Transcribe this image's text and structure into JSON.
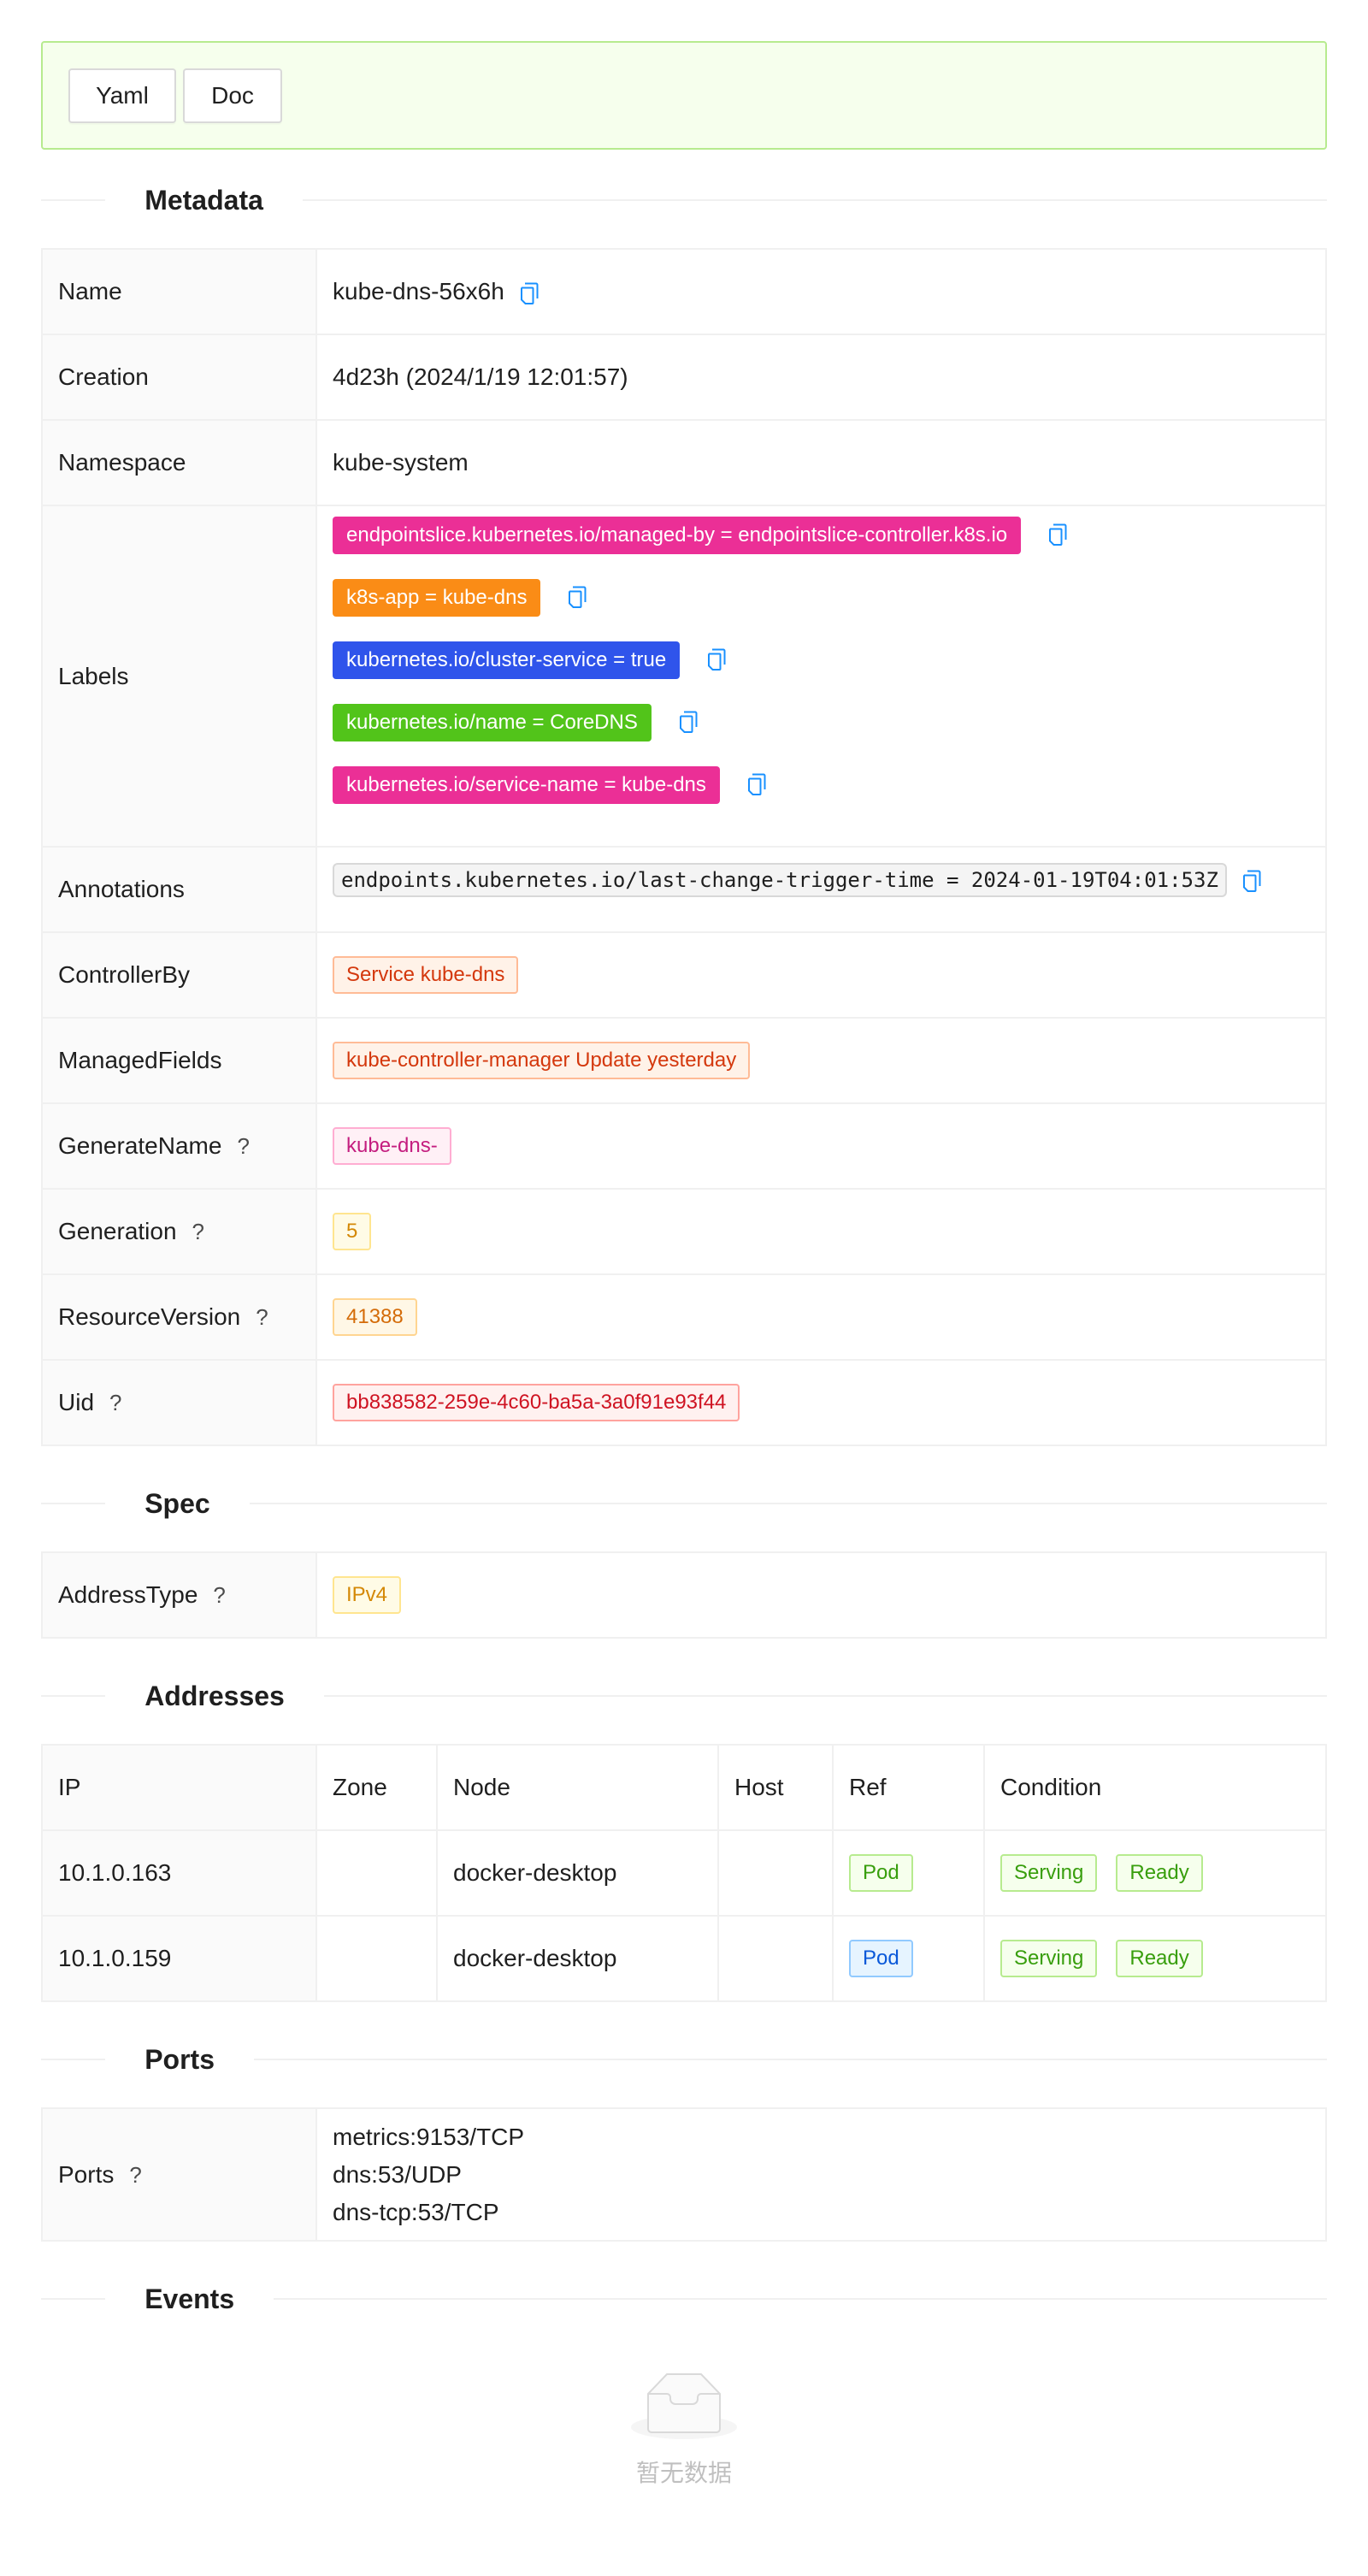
{
  "toolbar": {
    "yaml_label": "Yaml",
    "doc_label": "Doc"
  },
  "sections": {
    "metadata": "Metadata",
    "spec": "Spec",
    "addresses": "Addresses",
    "ports": "Ports",
    "events": "Events"
  },
  "metadata": {
    "name": {
      "label": "Name",
      "value": "kube-dns-56x6h"
    },
    "creation": {
      "label": "Creation",
      "value": "4d23h (2024/1/19 12:01:57)"
    },
    "namespace": {
      "label": "Namespace",
      "value": "kube-system"
    },
    "labels": {
      "label": "Labels",
      "items": [
        {
          "text": "endpointslice.kubernetes.io/managed-by = endpointslice-controller.k8s.io",
          "color": "#eb2f96"
        },
        {
          "text": "k8s-app = kube-dns",
          "color": "#fa8c16"
        },
        {
          "text": "kubernetes.io/cluster-service = true",
          "color": "#2f54eb"
        },
        {
          "text": "kubernetes.io/name = CoreDNS",
          "color": "#52c41a"
        },
        {
          "text": "kubernetes.io/service-name = kube-dns",
          "color": "#eb2f96"
        }
      ]
    },
    "annotations": {
      "label": "Annotations",
      "value": "endpoints.kubernetes.io/last-change-trigger-time = 2024-01-19T04:01:53Z"
    },
    "controller_by": {
      "label": "ControllerBy",
      "value": "Service kube-dns"
    },
    "managed_fields": {
      "label": "ManagedFields",
      "value": "kube-controller-manager Update yesterday"
    },
    "generate_name": {
      "label": "GenerateName",
      "value": "kube-dns-"
    },
    "generation": {
      "label": "Generation",
      "value": "5"
    },
    "resource_version": {
      "label": "ResourceVersion",
      "value": "41388"
    },
    "uid": {
      "label": "Uid",
      "value": "bb838582-259e-4c60-ba5a-3a0f91e93f44"
    },
    "help_glyph": "?"
  },
  "spec": {
    "address_type": {
      "label": "AddressType",
      "value": "IPv4"
    }
  },
  "addresses": {
    "columns": [
      "IP",
      "Zone",
      "Node",
      "Host",
      "Ref",
      "Condition"
    ],
    "rows": [
      {
        "ip": "10.1.0.163",
        "zone": "",
        "node": "docker-desktop",
        "host": "",
        "ref": "Pod",
        "ref_color": "green",
        "conditions": [
          "Serving",
          "Ready"
        ]
      },
      {
        "ip": "10.1.0.159",
        "zone": "",
        "node": "docker-desktop",
        "host": "",
        "ref": "Pod",
        "ref_color": "blue",
        "conditions": [
          "Serving",
          "Ready"
        ]
      }
    ]
  },
  "ports": {
    "label": "Ports",
    "values": [
      "metrics:9153/TCP",
      "dns:53/UDP",
      "dns-tcp:53/TCP"
    ]
  },
  "events": {
    "empty_text": "暂无数据"
  },
  "icons": {
    "copy": "copy-icon",
    "help": "question-icon",
    "empty": "empty-inbox-icon"
  }
}
